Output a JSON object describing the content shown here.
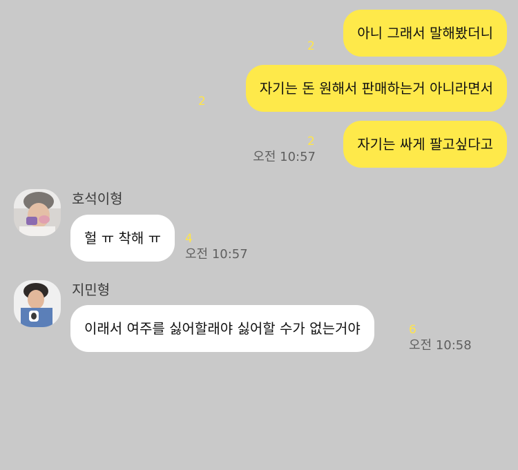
{
  "colors": {
    "background": "#c9c9c9",
    "my_bubble": "#fee94a",
    "other_bubble": "#ffffff",
    "unread_count": "#ffe54a",
    "time_text": "#5f5f5f"
  },
  "messages": {
    "m1": {
      "text": "아니 그래서 말해봤더니",
      "unread": "2"
    },
    "m2": {
      "text": "자기는 돈 원해서 판매하는거 아니라면서",
      "unread": "2"
    },
    "m3": {
      "text": "자기는 싸게 팔고싶다고",
      "unread": "2",
      "time": "오전 10:57"
    },
    "m4": {
      "sender": "호석이형",
      "text": "헐 ㅠ 착해 ㅠ",
      "unread": "4",
      "time": "오전 10:57",
      "avatar_icon": "profile-photo-icon"
    },
    "m5": {
      "sender": "지민형",
      "text": "이래서 여주를 싫어할래야 싫어할 수가 없는거야",
      "unread": "6",
      "time": "오전 10:58",
      "avatar_icon": "profile-photo-icon"
    }
  }
}
